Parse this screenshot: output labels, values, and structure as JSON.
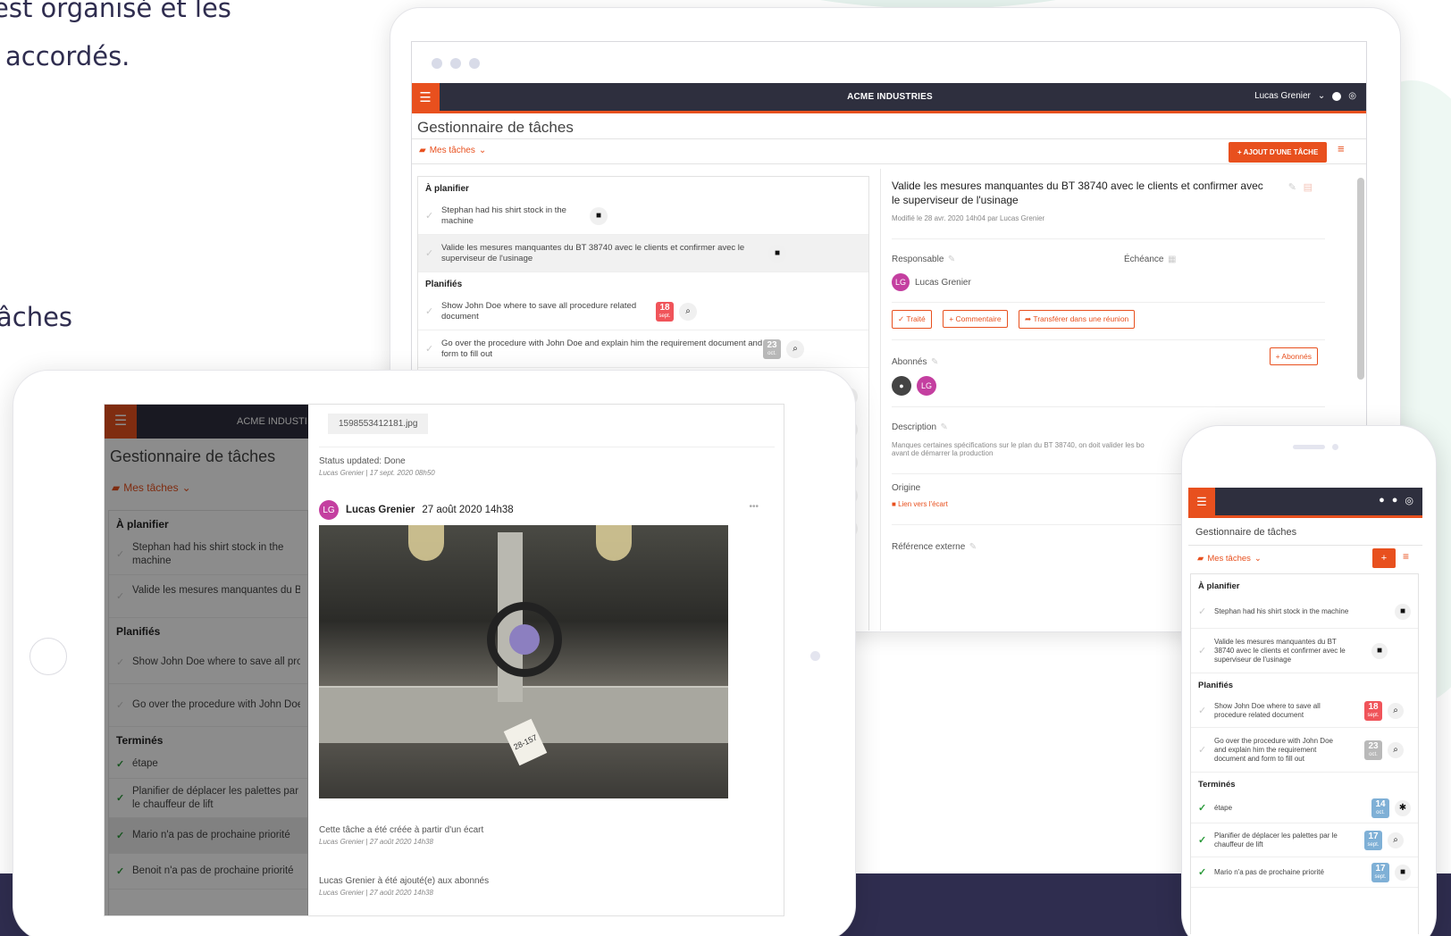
{
  "hero": {
    "line1": "est organisé et les",
    "line2": "accordés.",
    "line3": "âches"
  },
  "app": {
    "title": "ACME INDUSTRIES",
    "user": "Lucas Grenier",
    "page_title": "Gestionnaire de tâches",
    "my_tasks": "Mes tâches",
    "add_task": "+ AJOUT D'UNE TÂCHE",
    "sections": {
      "plan": "À planifier",
      "planned": "Planifiés",
      "done": "Terminés"
    },
    "tasks": {
      "t1": "Stephan had his shirt stock in the machine",
      "t2": "Valide les mesures manquantes du BT 38740 avec le clients et confirmer avec le superviseur de l'usinage",
      "t3": "Show John Doe where to save all procedure related document",
      "t4": "Go over the procedure with John Doe and explain him the requirement document and form to fill out",
      "t5": "étape",
      "t6": "Planifier de déplacer les palettes par le chauffeur de lift",
      "t7": "Mario n'a pas de prochaine priorité",
      "t8": "Benoit n'a pas de prochaine priorité"
    },
    "dates": {
      "d1": {
        "day": "18",
        "mon": "sept."
      },
      "d2": {
        "day": "23",
        "mon": "oct."
      },
      "d3": {
        "day": "14",
        "mon": "oct."
      },
      "d4": {
        "day": "17",
        "mon": "sept."
      },
      "d5": {
        "day": "17",
        "mon": "sept."
      }
    },
    "detail": {
      "title": "Valide les mesures manquantes du BT 38740 avec le clients et confirmer avec le superviseur de l'usinage",
      "modified": "Modifié le 28 avr. 2020 14h04 par Lucas Grenier",
      "responsable_label": "Responsable",
      "echeance_label": "Échéance",
      "initials": "LG",
      "btn_done": "✓ Traité",
      "btn_comment": "+ Commentaire",
      "btn_transfer": "➦ Transférer dans une réunion",
      "abonnes_label": "Abonnés",
      "abonnes_btn": "+ Abonnés",
      "description_label": "Description",
      "description": "Manques certaines spécifications sur le plan du BT 38740, on doit valider les bo",
      "description2": "avant de démarrer la production",
      "origine_label": "Origine",
      "origine_link": "Lien vers l'écart",
      "ref_label": "Référence externe"
    },
    "feed": {
      "file": "1598553412181.jpg",
      "status": "Status updated: Done",
      "status_meta": "Lucas Grenier | 17 sept. 2020 08h50",
      "author": "Lucas Grenier",
      "post_date": "27 août 2020 14h38",
      "created": "Cette tâche a été créée à partir d'un écart",
      "created_meta": "Lucas Grenier | 27 août 2020 14h38",
      "added": "Lucas Grenier à été ajouté(e) aux abonnés",
      "added_meta": "Lucas Grenier | 27 août 2020 14h38",
      "more": "•••",
      "tag": "28-157"
    },
    "tablet_title": "ACME INDUSTI"
  },
  "colors": {
    "accent": "#e8501e",
    "topbar": "#2e2f3e",
    "navy": "#2f2d4f",
    "red_date": "#f0545a",
    "grey_date": "#b9b9b9",
    "blue_date": "#7fb0d6"
  }
}
